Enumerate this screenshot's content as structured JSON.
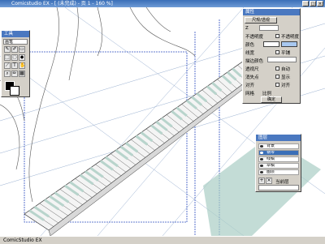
{
  "app": {
    "title": "Comicstudio EX - [ (未完成) - 页 1 - 160 %]",
    "status": "ComicStudio EX",
    "window_buttons": [
      "_",
      "□",
      "×"
    ]
  },
  "tool_panel": {
    "title": "工具",
    "field": "画笔"
  },
  "props_panel": {
    "title": "属性",
    "tab": "尺规/透视",
    "rows": [
      {
        "label": "Z"
      },
      {
        "label": "不透明度"
      },
      {
        "label": "颜色"
      },
      {
        "label": "线宽"
      },
      {
        "label": "描边颜色"
      },
      {
        "label": "透视尺"
      },
      {
        "label": "消失点"
      },
      {
        "label": "对齐"
      },
      {
        "label": "网格"
      },
      {
        "label": "比例"
      }
    ],
    "checks": [
      "不透明度",
      "平铺",
      "自动",
      "显示",
      "对齐"
    ],
    "button": "确定"
  },
  "layers_panel": {
    "title": "图层",
    "items": [
      {
        "name": "背景"
      },
      {
        "name": "钢琴",
        "selected": true
      },
      {
        "name": "线稿"
      },
      {
        "name": "草稿"
      },
      {
        "name": "图层"
      }
    ],
    "footer": "当前层"
  }
}
